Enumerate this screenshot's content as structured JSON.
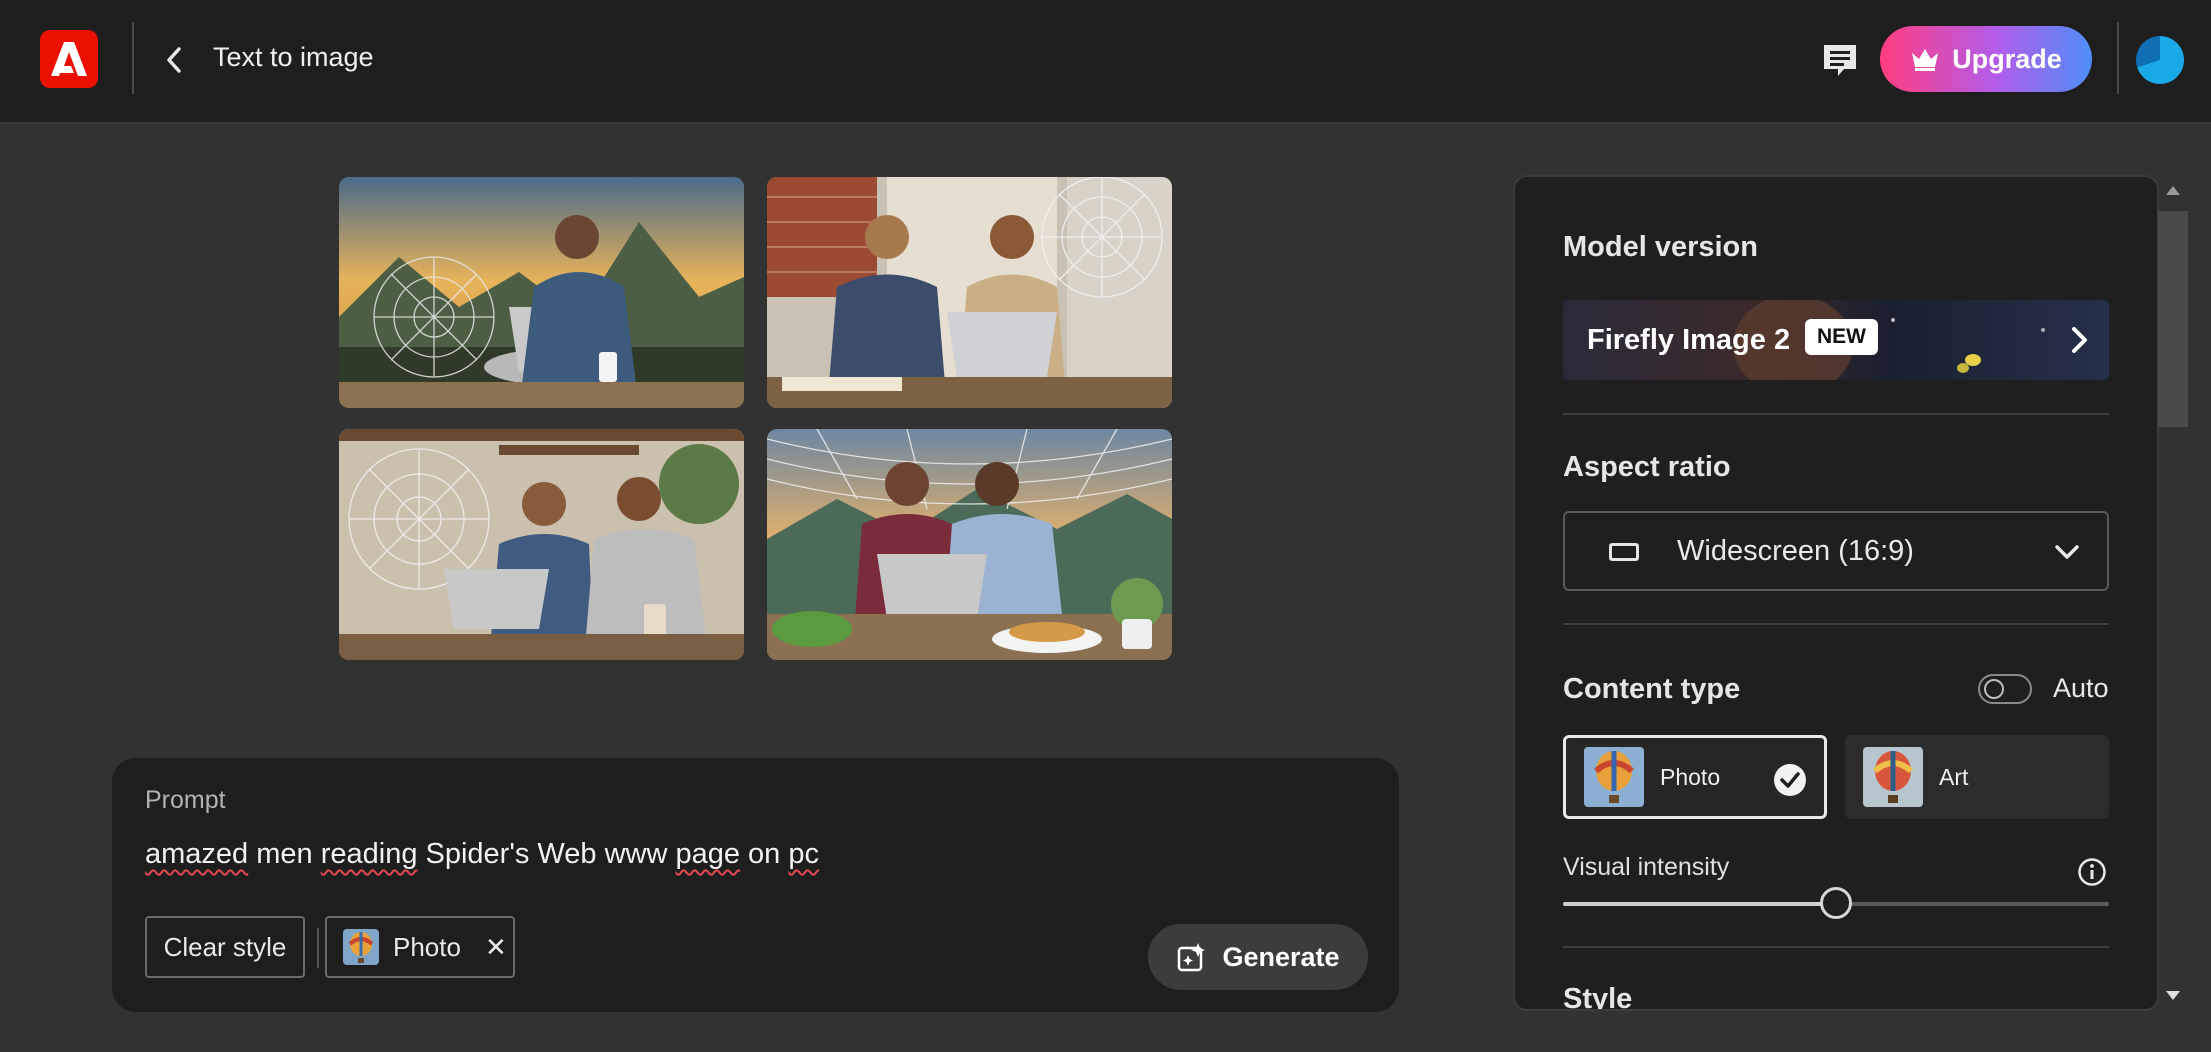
{
  "header": {
    "title": "Text to image",
    "upgrade_label": "Upgrade"
  },
  "gallery": {
    "images": [
      {
        "name": "man with laptop and spider web, mountains at sunset"
      },
      {
        "name": "two men with laptop, spider web, brick wall"
      },
      {
        "name": "two men with laptop, spider web, shelves"
      },
      {
        "name": "two men with laptop, spider web, mountains and breakfast"
      }
    ]
  },
  "prompt": {
    "label": "Prompt",
    "text_parts": [
      "amazed",
      " men ",
      "reading",
      " Spider's Web www ",
      "page",
      " on ",
      "pc"
    ],
    "clear_style_label": "Clear style",
    "chip_label": "Photo",
    "chip_close": "✕",
    "generate_label": "Generate"
  },
  "panel": {
    "model_heading": "Model version",
    "model_name": "Firefly Image 2",
    "model_badge": "NEW",
    "aspect_heading": "Aspect ratio",
    "aspect_value": "Widescreen (16:9)",
    "content_heading": "Content type",
    "auto_label": "Auto",
    "auto_enabled": false,
    "content_types": [
      {
        "label": "Photo",
        "selected": true
      },
      {
        "label": "Art",
        "selected": false
      }
    ],
    "visual_intensity_label": "Visual intensity",
    "visual_intensity_fraction": 0.5,
    "style_heading": "Style"
  },
  "colors": {
    "background": "#323232",
    "header": "#1e1e1e",
    "adobe_red": "#eb1000",
    "upgrade_gradient_start": "#ff3d7f",
    "upgrade_gradient_end": "#4f8ef7"
  }
}
